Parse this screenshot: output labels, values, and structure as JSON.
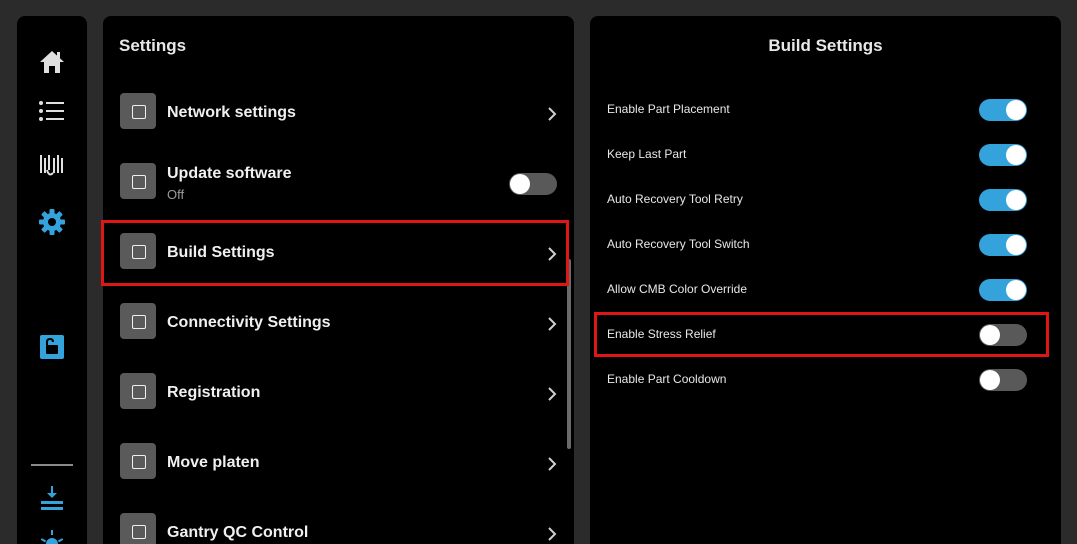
{
  "rail": {
    "icons": [
      "home-icon",
      "list-icon",
      "build-queue-icon",
      "gear-icon",
      "unlock-icon",
      "download-tray-icon",
      "sun-icon"
    ],
    "active": "gear-icon",
    "accent": "#35a3db"
  },
  "settings": {
    "title": "Settings",
    "items": [
      {
        "label": "Network settings",
        "icon": "square-icon",
        "control": "chevron"
      },
      {
        "label": "Update software",
        "sublabel": "Off",
        "icon": "square-icon",
        "control": "toggle",
        "toggle_on": false
      },
      {
        "label": "Build Settings",
        "icon": "square-icon",
        "control": "chevron",
        "highlighted": true
      },
      {
        "label": "Connectivity Settings",
        "icon": "square-icon",
        "control": "chevron"
      },
      {
        "label": "Registration",
        "icon": "square-icon",
        "control": "chevron"
      },
      {
        "label": "Move platen",
        "icon": "square-icon",
        "control": "chevron"
      },
      {
        "label": "Gantry QC Control",
        "icon": "square-icon",
        "control": "chevron"
      }
    ]
  },
  "build_settings": {
    "title": "Build Settings",
    "rows": [
      {
        "label": "Enable Part Placement",
        "on": true
      },
      {
        "label": "Keep Last Part",
        "on": true
      },
      {
        "label": "Auto Recovery Tool Retry",
        "on": true
      },
      {
        "label": "Auto Recovery Tool Switch",
        "on": true
      },
      {
        "label": "Allow CMB Color Override",
        "on": true
      },
      {
        "label": "Enable Stress Relief",
        "on": false,
        "highlighted": true
      },
      {
        "label": "Enable Part Cooldown",
        "on": false
      }
    ]
  },
  "colors": {
    "toggle_on": "#35a3db",
    "toggle_off": "#595959",
    "highlight": "#e01515"
  }
}
